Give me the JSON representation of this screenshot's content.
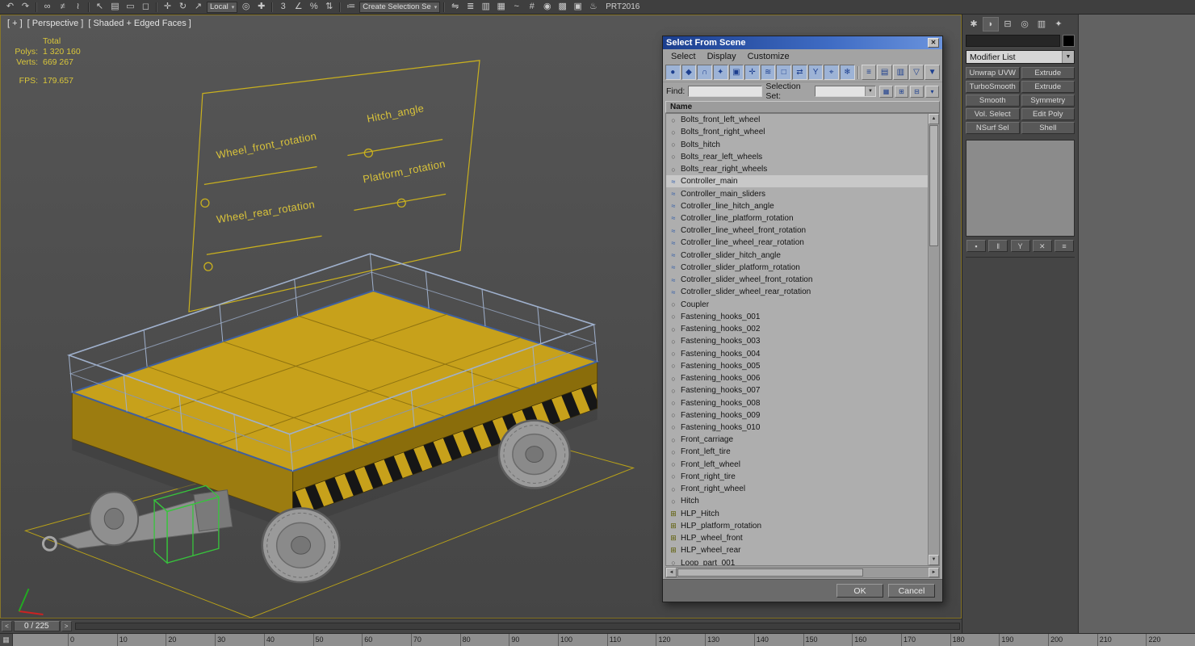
{
  "colors": {
    "accent_yellow": "#d8c23a",
    "selection_green": "#37c43c",
    "title_blue": "#1b3e8e"
  },
  "topbar": {
    "items": [
      {
        "type": "icon",
        "name": "undo-icon",
        "glyph": "↶"
      },
      {
        "type": "icon",
        "name": "redo-icon",
        "glyph": "↷"
      },
      {
        "type": "sep"
      },
      {
        "type": "icon",
        "name": "select-link-icon",
        "glyph": "∞"
      },
      {
        "type": "icon",
        "name": "unlink-icon",
        "glyph": "≠"
      },
      {
        "type": "icon",
        "name": "bind-to-spacewarp-icon",
        "glyph": "≀"
      },
      {
        "type": "sep"
      },
      {
        "type": "icon",
        "name": "select-object-icon",
        "glyph": "↖"
      },
      {
        "type": "icon",
        "name": "select-by-name-icon",
        "glyph": "▤"
      },
      {
        "type": "icon",
        "name": "rectangular-selection-icon",
        "glyph": "▭"
      },
      {
        "type": "icon",
        "name": "crossing-selection-icon",
        "glyph": "◻"
      },
      {
        "type": "sep"
      },
      {
        "type": "icon",
        "name": "select-and-move-icon",
        "glyph": "✛"
      },
      {
        "type": "icon",
        "name": "select-and-rotate-icon",
        "glyph": "↻"
      },
      {
        "type": "icon",
        "name": "select-and-scale-icon",
        "glyph": "↗"
      },
      {
        "type": "dropdown",
        "name": "reference-coordinate-dropdown",
        "text": "Local"
      },
      {
        "type": "icon",
        "name": "use-pivot-center-icon",
        "glyph": "◎"
      },
      {
        "type": "icon",
        "name": "select-and-manipulate-icon",
        "glyph": "✚"
      },
      {
        "type": "sep"
      },
      {
        "type": "icon",
        "name": "snap-toggle-icon",
        "glyph": "3"
      },
      {
        "type": "icon",
        "name": "angle-snap-icon",
        "glyph": "∠"
      },
      {
        "type": "icon",
        "name": "percent-snap-icon",
        "glyph": "%"
      },
      {
        "type": "icon",
        "name": "spinner-snap-icon",
        "glyph": "⇅"
      },
      {
        "type": "sep"
      },
      {
        "type": "icon",
        "name": "edit-named-selections-icon",
        "glyph": "≔"
      },
      {
        "type": "dropdown",
        "name": "named-selection-set-dropdown",
        "text": "Create Selection Se"
      },
      {
        "type": "sep"
      },
      {
        "type": "icon",
        "name": "mirror-icon",
        "glyph": "⇋"
      },
      {
        "type": "icon",
        "name": "align-icon",
        "glyph": "≣"
      },
      {
        "type": "icon",
        "name": "layer-manager-icon",
        "glyph": "▥"
      },
      {
        "type": "icon",
        "name": "ribbon-icon",
        "glyph": "▦"
      },
      {
        "type": "icon",
        "name": "curve-editor-icon",
        "glyph": "~"
      },
      {
        "type": "icon",
        "name": "schematic-view-icon",
        "glyph": "#"
      },
      {
        "type": "icon",
        "name": "material-editor-icon",
        "glyph": "◉"
      },
      {
        "type": "icon",
        "name": "render-setup-icon",
        "glyph": "▩"
      },
      {
        "type": "icon",
        "name": "rendered-frame-window-icon",
        "glyph": "▣"
      },
      {
        "type": "icon",
        "name": "render-production-icon",
        "glyph": "♨"
      },
      {
        "type": "label",
        "name": "prt-label",
        "text": "PRT2016"
      }
    ]
  },
  "viewport": {
    "labels": {
      "plus": "[ + ]",
      "view": "[ Perspective ]",
      "shading": "[ Shaded + Edged Faces ]"
    },
    "stats": {
      "total": "Total",
      "polys_label": "Polys:",
      "polys": "1 320 160",
      "verts_label": "Verts:",
      "verts": "669 267",
      "fps_label": "FPS:",
      "fps": "179.657"
    }
  },
  "scene": {
    "labels": {
      "wheel_front": "Wheel_front_rotation",
      "hitch": "Hitch_angle",
      "platform": "Platform_rotation",
      "wheel_rear": "Wheel_rear_rotation"
    }
  },
  "dialog": {
    "title": "Select From Scene",
    "menus": [
      "Select",
      "Display",
      "Customize"
    ],
    "toolbar_icons": [
      {
        "name": "display-all-icon",
        "glyph": "●",
        "toggled": true
      },
      {
        "name": "display-geometry-icon",
        "glyph": "◆",
        "toggled": true
      },
      {
        "name": "display-shapes-icon",
        "glyph": "∩",
        "toggled": true
      },
      {
        "name": "display-lights-icon",
        "glyph": "✦",
        "toggled": true
      },
      {
        "name": "display-cameras-icon",
        "glyph": "▣",
        "toggled": true
      },
      {
        "name": "display-helpers-icon",
        "glyph": "✛",
        "toggled": true
      },
      {
        "name": "display-spacewarps-icon",
        "glyph": "≋",
        "toggled": true
      },
      {
        "name": "display-groups-icon",
        "glyph": "□",
        "toggled": true
      },
      {
        "name": "display-xrefs-icon",
        "glyph": "⇄",
        "toggled": true
      },
      {
        "name": "display-bones-icon",
        "glyph": "Y",
        "toggled": true
      },
      {
        "name": "display-containers-icon",
        "glyph": "⌖",
        "toggled": true
      },
      {
        "name": "display-frozen-icon",
        "glyph": "❄",
        "toggled": true
      },
      {
        "name": "sep"
      },
      {
        "name": "list-view-icon",
        "glyph": "≡",
        "toggled": false
      },
      {
        "name": "detail-view-icon",
        "glyph": "▤",
        "toggled": false
      },
      {
        "name": "column-chooser-icon",
        "glyph": "▥",
        "toggled": false
      },
      {
        "name": "filter-icon",
        "glyph": "▽",
        "toggled": false
      },
      {
        "name": "advanced-filter-icon",
        "glyph": "▼",
        "toggled": false
      }
    ],
    "find_label": "Find:",
    "selection_set_label": "Selection Set:",
    "set_buttons": [
      {
        "name": "edit-sets-icon",
        "glyph": "▦"
      },
      {
        "name": "add-set-icon",
        "glyph": "⊞"
      },
      {
        "name": "remove-set-icon",
        "glyph": "⊟"
      },
      {
        "name": "selection-set-menu-icon",
        "glyph": "▾"
      }
    ],
    "column_header": "Name",
    "icon_glyphs": {
      "geometry": "○",
      "spline": "≈",
      "helper": "⊞"
    },
    "items": [
      {
        "label": "Bolts_front_left_wheel",
        "icon": "geometry",
        "selected": false
      },
      {
        "label": "Bolts_front_right_wheel",
        "icon": "geometry",
        "selected": false
      },
      {
        "label": "Bolts_hitch",
        "icon": "geometry",
        "selected": false
      },
      {
        "label": "Bolts_rear_left_wheels",
        "icon": "geometry",
        "selected": false
      },
      {
        "label": "Bolts_rear_right_wheels",
        "icon": "geometry",
        "selected": false
      },
      {
        "label": "Controller_main",
        "icon": "spline",
        "selected": true
      },
      {
        "label": "Controller_main_sliders",
        "icon": "spline",
        "selected": false
      },
      {
        "label": "Cotroller_line_hitch_angle",
        "icon": "spline",
        "selected": false
      },
      {
        "label": "Cotroller_line_platform_rotation",
        "icon": "spline",
        "selected": false
      },
      {
        "label": "Cotroller_line_wheel_front_rotation",
        "icon": "spline",
        "selected": false
      },
      {
        "label": "Cotroller_line_wheel_rear_rotation",
        "icon": "spline",
        "selected": false
      },
      {
        "label": "Cotroller_slider_hitch_angle",
        "icon": "spline",
        "selected": false
      },
      {
        "label": "Cotroller_slider_platform_rotation",
        "icon": "spline",
        "selected": false
      },
      {
        "label": "Cotroller_slider_wheel_front_rotation",
        "icon": "spline",
        "selected": false
      },
      {
        "label": "Cotroller_slider_wheel_rear_rotation",
        "icon": "spline",
        "selected": false
      },
      {
        "label": "Coupler",
        "icon": "geometry",
        "selected": false
      },
      {
        "label": "Fastening_hooks_001",
        "icon": "geometry",
        "selected": false
      },
      {
        "label": "Fastening_hooks_002",
        "icon": "geometry",
        "selected": false
      },
      {
        "label": "Fastening_hooks_003",
        "icon": "geometry",
        "selected": false
      },
      {
        "label": "Fastening_hooks_004",
        "icon": "geometry",
        "selected": false
      },
      {
        "label": "Fastening_hooks_005",
        "icon": "geometry",
        "selected": false
      },
      {
        "label": "Fastening_hooks_006",
        "icon": "geometry",
        "selected": false
      },
      {
        "label": "Fastening_hooks_007",
        "icon": "geometry",
        "selected": false
      },
      {
        "label": "Fastening_hooks_008",
        "icon": "geometry",
        "selected": false
      },
      {
        "label": "Fastening_hooks_009",
        "icon": "geometry",
        "selected": false
      },
      {
        "label": "Fastening_hooks_010",
        "icon": "geometry",
        "selected": false
      },
      {
        "label": "Front_carriage",
        "icon": "geometry",
        "selected": false
      },
      {
        "label": "Front_left_tire",
        "icon": "geometry",
        "selected": false
      },
      {
        "label": "Front_left_wheel",
        "icon": "geometry",
        "selected": false
      },
      {
        "label": "Front_right_tire",
        "icon": "geometry",
        "selected": false
      },
      {
        "label": "Front_right_wheel",
        "icon": "geometry",
        "selected": false
      },
      {
        "label": "Hitch",
        "icon": "geometry",
        "selected": false
      },
      {
        "label": "HLP_Hitch",
        "icon": "helper",
        "selected": false
      },
      {
        "label": "HLP_platform_rotation",
        "icon": "helper",
        "selected": false
      },
      {
        "label": "HLP_wheel_front",
        "icon": "helper",
        "selected": false
      },
      {
        "label": "HLP_wheel_rear",
        "icon": "helper",
        "selected": false
      },
      {
        "label": "Loop_part_001",
        "icon": "geometry",
        "selected": false
      }
    ],
    "ok": "OK",
    "cancel": "Cancel"
  },
  "command_panel": {
    "tabs": [
      {
        "name": "create-tab",
        "glyph": "✱",
        "active": false
      },
      {
        "name": "modify-tab",
        "glyph": "◗",
        "active": true
      },
      {
        "name": "hierarchy-tab",
        "glyph": "⊟",
        "active": false
      },
      {
        "name": "motion-tab",
        "glyph": "◎",
        "active": false
      },
      {
        "name": "display-tab",
        "glyph": "▥",
        "active": false
      },
      {
        "name": "utilities-tab",
        "glyph": "✦",
        "active": false
      }
    ],
    "modifier_list_label": "Modifier List",
    "buttons": [
      "Unwrap UVW",
      "Extrude",
      "TurboSmooth",
      "Extrude",
      "Smooth",
      "Symmetry",
      "Vol. Select",
      "Edit Poly",
      "NSurf Sel",
      "Shell"
    ],
    "stack_icons": [
      {
        "name": "pin-stack-icon",
        "glyph": "▪"
      },
      {
        "name": "show-end-result-icon",
        "glyph": "‖"
      },
      {
        "name": "make-unique-icon",
        "glyph": "Y"
      },
      {
        "name": "remove-modifier-icon",
        "glyph": "✕"
      },
      {
        "name": "configure-modifier-sets-icon",
        "glyph": "≡"
      }
    ]
  },
  "timeline": {
    "frame": "0 / 225",
    "prev_arrow": "<",
    "next_arrow": ">",
    "ticks": [
      "0",
      "10",
      "20",
      "30",
      "40",
      "50",
      "60",
      "70",
      "80",
      "90",
      "100",
      "110",
      "120",
      "130",
      "140",
      "150",
      "160",
      "170",
      "180",
      "190",
      "200",
      "210",
      "220"
    ]
  }
}
